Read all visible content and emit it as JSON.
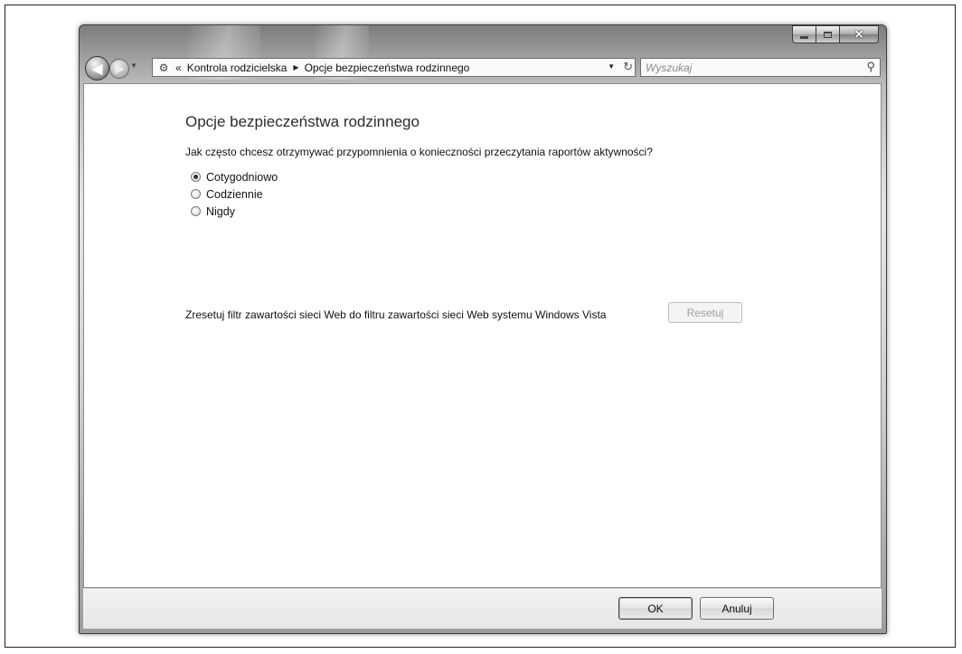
{
  "navigation": {
    "breadcrumb_overflow": "«",
    "breadcrumbs": [
      "Kontrola rodzicielska",
      "Opcje bezpieczeństwa rodzinnego"
    ],
    "search_placeholder": "Wyszukaj"
  },
  "main": {
    "title": "Opcje bezpieczeństwa rodzinnego",
    "question": "Jak często chcesz otrzymywać przypomnienia o konieczności przeczytania raportów aktywności?",
    "options": [
      {
        "label": "Cotygodniowo",
        "selected": true
      },
      {
        "label": "Codziennie",
        "selected": false
      },
      {
        "label": "Nigdy",
        "selected": false
      }
    ],
    "reset_text": "Zresetuj filtr zawartości sieci Web do filtru zawartości sieci Web systemu Windows Vista",
    "reset_button": "Resetuj"
  },
  "footer": {
    "ok_label": "OK",
    "cancel_label": "Anuluj"
  },
  "icons": {
    "back": "back-arrow-icon",
    "forward": "forward-arrow-icon",
    "control_panel": "parental-controls-icon",
    "search": "search-icon",
    "refresh": "refresh-icon"
  }
}
